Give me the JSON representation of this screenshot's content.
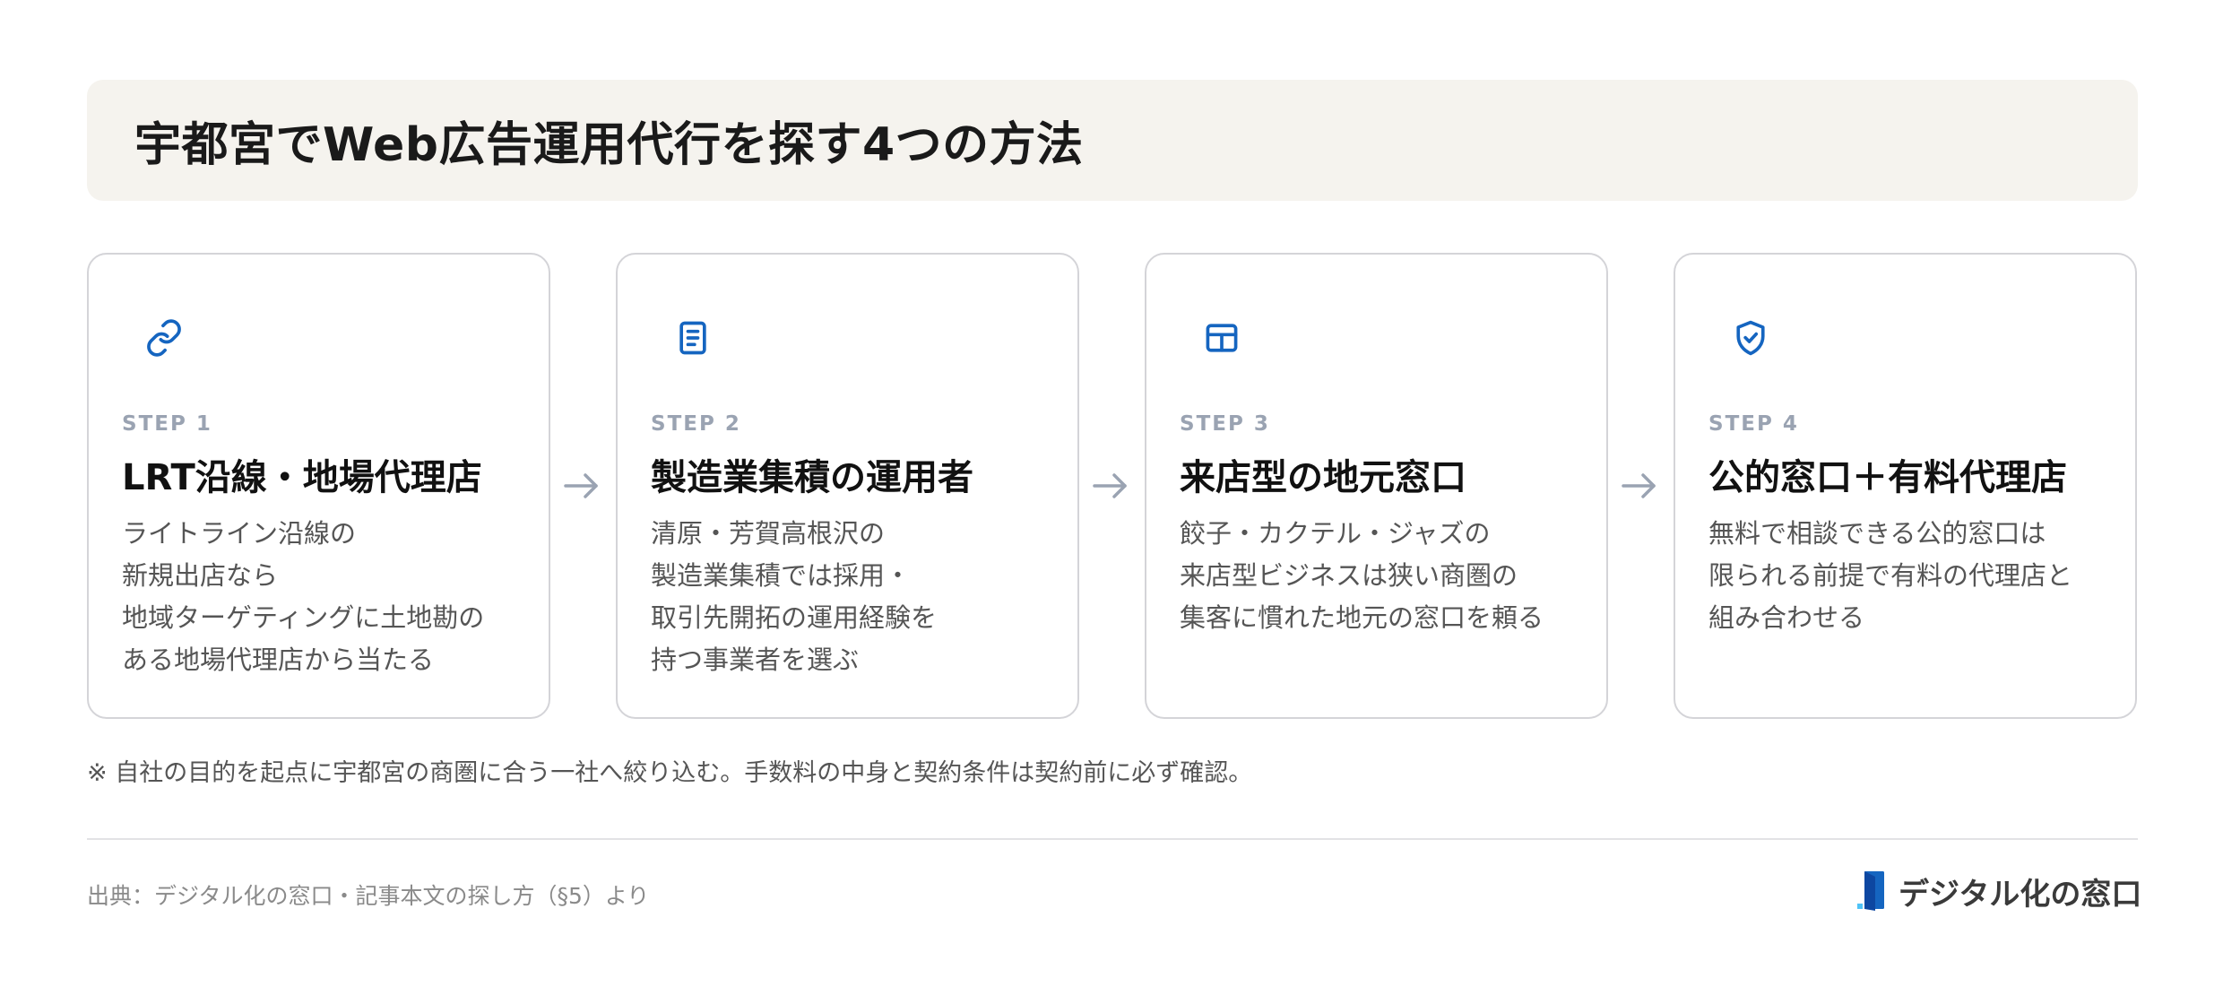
{
  "header": {
    "title": "宇都宮でWeb広告運用代行を探す4つの方法"
  },
  "steps": [
    {
      "icon": "link-icon",
      "step_label": "STEP 1",
      "title": "LRT沿線・地場代理店",
      "desc_lines": [
        "ライトライン沿線の",
        "新規出店なら",
        "地域ターゲティングに土地勘の",
        "ある地場代理店から当たる"
      ]
    },
    {
      "icon": "document-icon",
      "step_label": "STEP 2",
      "title": "製造業集積の運用者",
      "desc_lines": [
        "清原・芳賀高根沢の",
        "製造業集積では採用・",
        "取引先開拓の運用経験を",
        "持つ事業者を選ぶ"
      ]
    },
    {
      "icon": "layout-icon",
      "step_label": "STEP 3",
      "title": "来店型の地元窓口",
      "desc_lines": [
        "餃子・カクテル・ジャズの",
        "来店型ビジネスは狭い商圏の",
        "集客に慣れた地元の窓口を頼る"
      ]
    },
    {
      "icon": "shield-check-icon",
      "step_label": "STEP 4",
      "title": "公的窓口＋有料代理店",
      "desc_lines": [
        "無料で相談できる公的窓口は",
        "限られる前提で有料の代理店と",
        "組み合わせる"
      ]
    }
  ],
  "note": "※ 自社の目的を起点に宇都宮の商圏に合う一社へ絞り込む。手数料の中身と契約条件は契約前に必ず確認。",
  "footer": {
    "source": "出典：デジタル化の窓口・記事本文の探し方（§5）より",
    "brand_name": "デジタル化の窓口"
  },
  "colors": {
    "accent": "#1565c0",
    "title_band": "#f5f3ee",
    "step_label": "#9aa3b2",
    "arrow": "#9aa3b2",
    "card_border": "#d4d4d8"
  }
}
